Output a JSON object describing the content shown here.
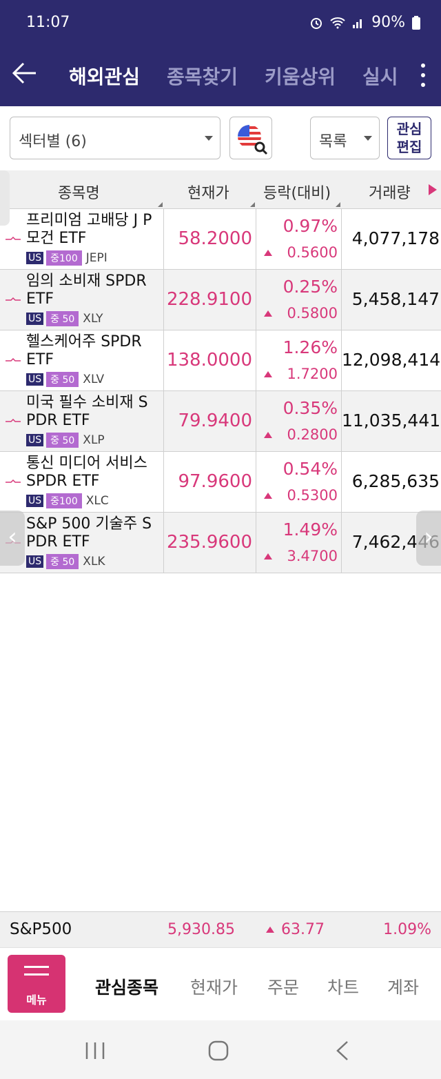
{
  "status_bar": {
    "time": "11:07",
    "battery": "90%"
  },
  "app_bar": {
    "tabs": [
      {
        "label": "해외관심",
        "active": true
      },
      {
        "label": "종목찾기",
        "active": false
      },
      {
        "label": "키움상위",
        "active": false
      },
      {
        "label": "실시",
        "active": false
      }
    ]
  },
  "filters": {
    "group_select": "섹터별 (6)",
    "view_select": "목록",
    "edit_button": [
      "관심",
      "편집"
    ]
  },
  "table": {
    "headers": [
      "종목명",
      "현재가",
      "등락(대비)",
      "거래량"
    ],
    "rows": [
      {
        "name": "프리미엄 고배당 J P모건 ETF",
        "market": "US",
        "group": "중100",
        "ticker": "JEPI",
        "price": "58.2000",
        "pct": "0.97%",
        "change": "0.5600",
        "volume": "4,077,178"
      },
      {
        "name": "임의 소비재 SPDR ETF",
        "market": "US",
        "group": "중 50",
        "ticker": "XLY",
        "price": "228.9100",
        "pct": "0.25%",
        "change": "0.5800",
        "volume": "5,458,147"
      },
      {
        "name": "헬스케어주 SPDR ETF",
        "market": "US",
        "group": "중 50",
        "ticker": "XLV",
        "price": "138.0000",
        "pct": "1.26%",
        "change": "1.7200",
        "volume": "12,098,414"
      },
      {
        "name": "미국 필수 소비재 S PDR ETF",
        "market": "US",
        "group": "중 50",
        "ticker": "XLP",
        "price": "79.9400",
        "pct": "0.35%",
        "change": "0.2800",
        "volume": "11,035,441"
      },
      {
        "name": "통신 미디어 서비스 SPDR ETF",
        "market": "US",
        "group": "중100",
        "ticker": "XLC",
        "price": "97.9600",
        "pct": "0.54%",
        "change": "0.5300",
        "volume": "6,285,635"
      },
      {
        "name": "S&P 500 기술주 S PDR ETF",
        "market": "US",
        "group": "중 50",
        "ticker": "XLK",
        "price": "235.9600",
        "pct": "1.49%",
        "change": "3.4700",
        "volume": "7,462,446"
      }
    ]
  },
  "index_bar": {
    "name": "S&P500",
    "value": "5,930.85",
    "change": "63.77",
    "pct": "1.09%"
  },
  "bottom_nav": {
    "menu_label": "메뉴",
    "items": [
      {
        "label": "관심종목",
        "active": true
      },
      {
        "label": "현재가",
        "active": false
      },
      {
        "label": "주문",
        "active": false
      },
      {
        "label": "차트",
        "active": false
      },
      {
        "label": "계좌",
        "active": false
      }
    ]
  },
  "colors": {
    "header_bg": "#2d2a6e",
    "up": "#d8387a",
    "menu_bg": "#d63372",
    "group_badge": "#b36ad0"
  }
}
